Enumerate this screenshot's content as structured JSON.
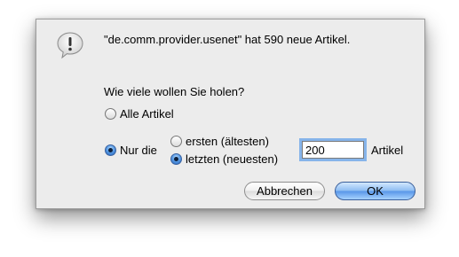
{
  "dialog": {
    "message": "\"de.comm.provider.usenet\" hat 590 neue Artikel.",
    "question": "Wie viele wollen Sie holen?",
    "icon": "alert-icon"
  },
  "options": {
    "all_label": "Alle Artikel",
    "all_selected": false,
    "only_label": "Nur die",
    "only_selected": true,
    "first_label": "ersten (ältesten)",
    "first_selected": false,
    "last_label": "letzten (neuesten)",
    "last_selected": true
  },
  "count": {
    "value": "200",
    "unit_label": "Artikel"
  },
  "buttons": {
    "cancel_label": "Abbrechen",
    "ok_label": "OK"
  },
  "colors": {
    "dialog_background": "#ececec",
    "accent_blue": "#5896e8",
    "focus_ring": "#86b4ea"
  }
}
